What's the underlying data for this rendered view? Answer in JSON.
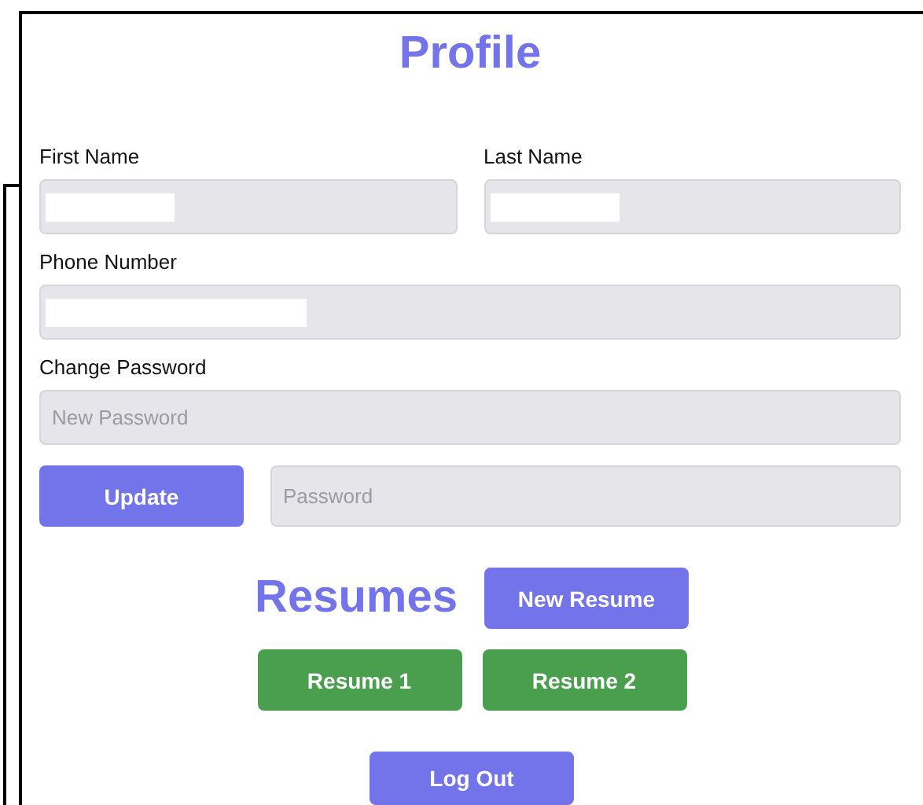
{
  "title": "Profile",
  "name_fields": [
    {
      "label": "First Name",
      "redacted": true
    },
    {
      "label": "Last Name",
      "redacted": true
    }
  ],
  "phone_field": {
    "label": "Phone Number",
    "redacted": true
  },
  "password_section": {
    "label": "Change Password",
    "new_password": {
      "placeholder": "New Password"
    },
    "update_button": "Update",
    "current_password": {
      "placeholder": "Password"
    }
  },
  "resumes": {
    "heading": "Resumes",
    "new_button": "New Resume",
    "items": [
      "Resume 1",
      "Resume 2"
    ]
  },
  "logout_button": "Log Out"
}
